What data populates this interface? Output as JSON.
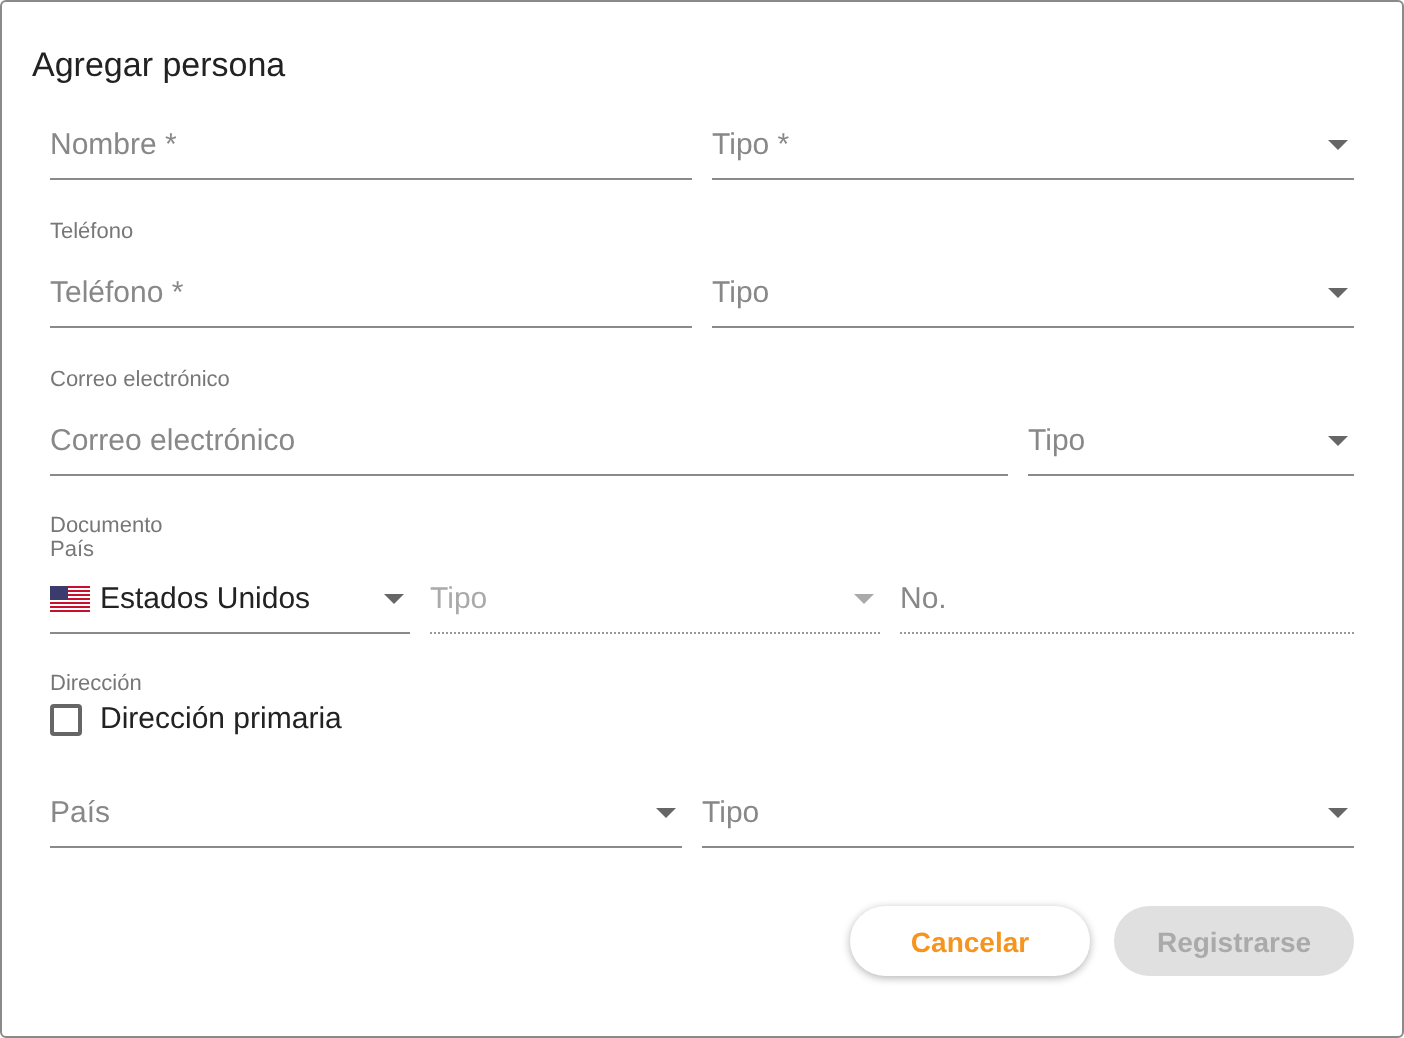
{
  "dialog": {
    "title": "Agregar persona"
  },
  "sections": [
    {
      "fields": [
        {
          "kind": "text",
          "placeholder": "Nombre *",
          "disabled": false
        },
        {
          "kind": "select",
          "placeholder": "Tipo *",
          "disabled": false
        }
      ]
    },
    {
      "label": "Teléfono",
      "fields": [
        {
          "kind": "text",
          "placeholder": "Teléfono *",
          "disabled": false
        },
        {
          "kind": "select",
          "placeholder": "Tipo",
          "disabled": false
        }
      ]
    },
    {
      "label": "Correo electrónico",
      "fields": [
        {
          "kind": "text",
          "placeholder": "Correo electrónico",
          "disabled": false
        },
        {
          "kind": "select",
          "placeholder": "Tipo",
          "disabled": false
        }
      ]
    },
    {
      "label": "Documento",
      "sublabel": "País",
      "fields": [
        {
          "kind": "country",
          "value": "Estados Unidos",
          "disabled": false
        },
        {
          "kind": "select",
          "placeholder": "Tipo",
          "disabled": true
        },
        {
          "kind": "text",
          "placeholder": "No.",
          "disabled": true
        }
      ]
    },
    {
      "label": "Dirección",
      "checkbox": {
        "label": "Dirección primaria",
        "checked": false
      },
      "fields": [
        {
          "kind": "select",
          "placeholder": "País",
          "disabled": false
        },
        {
          "kind": "select",
          "placeholder": "Tipo",
          "disabled": false
        }
      ]
    }
  ],
  "buttons": [
    {
      "label": "Cancelar",
      "disabled": false
    },
    {
      "label": "Registrarse",
      "disabled": true
    }
  ]
}
